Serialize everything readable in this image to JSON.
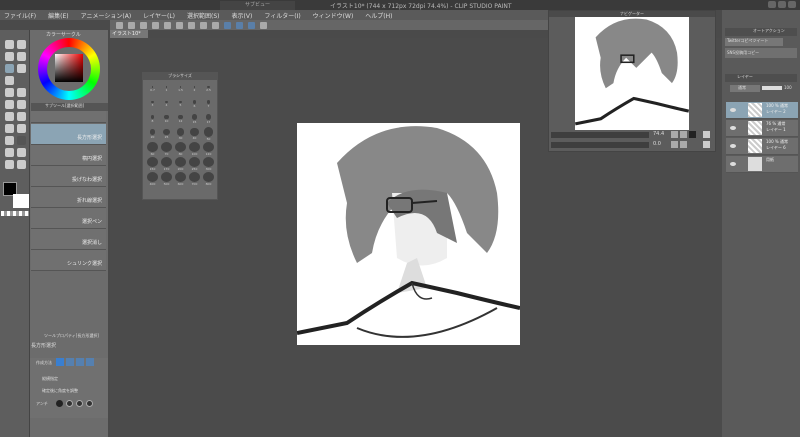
{
  "window": {
    "title": "イラスト10* (744 x 712px 72dpi 74.4%) - CLIP STUDIO PAINT",
    "floating_title_1": "サブビュー",
    "floating_title_2": "ナビゲーター"
  },
  "menu": [
    "ファイル(F)",
    "編集(E)",
    "アニメーション(A)",
    "レイヤー(L)",
    "選択範囲(S)",
    "表示(V)",
    "フィルター(I)",
    "ウィンドウ(W)",
    "ヘルプ(H)"
  ],
  "document_tab": "イラスト10*",
  "color_panel": {
    "title": "カラーサークル",
    "main_color": "#000000",
    "sub_color": "#ffffff"
  },
  "subtool": {
    "title": "サブツール[選択範囲]",
    "items": [
      "長方形選択",
      "楕円選択",
      "投げなわ選択",
      "折れ線選択",
      "選択ペン",
      "選択消し",
      "シュリンク選択"
    ],
    "selected": 0
  },
  "tool_property": {
    "title": "ツールプロパティ[長方形選択]",
    "tool_name": "長方形選択",
    "mode_label": "作成方法",
    "aspect_label": "縦横指定",
    "adjust_label": "確定後に角度を調整",
    "antialias_label": "アンチ"
  },
  "brush_size": {
    "title": "ブラシサイズ",
    "sizes": [
      "0.7",
      "1",
      "1.5",
      "2",
      "2.5",
      "3",
      "4",
      "5",
      "6",
      "7",
      "8",
      "10",
      "12",
      "15",
      "17",
      "20",
      "25",
      "30",
      "40",
      "50",
      "60",
      "70",
      "80",
      "100",
      "120",
      "150",
      "170",
      "200",
      "250",
      "300",
      "400",
      "500",
      "600",
      "700",
      "800"
    ]
  },
  "navigator": {
    "zoom": "74.4",
    "rotation": "0.0"
  },
  "auto_action": {
    "tab": "オートアクション",
    "set": "Twitterコピペツイート",
    "action": "SNS投稿用コピー"
  },
  "layers": {
    "tab": "レイヤー",
    "blend_mode": "通常",
    "opacity": "100",
    "items": [
      {
        "mode": "100 % 通常",
        "name": "レイヤー 2",
        "selected": true
      },
      {
        "mode": "76 % 通常",
        "name": "レイヤー 1",
        "selected": false
      },
      {
        "mode": "100 % 通常",
        "name": "レイヤー 6",
        "selected": false
      },
      {
        "mode": "",
        "name": "用紙",
        "selected": false
      }
    ]
  },
  "colors": {
    "accent": "#8ba4b4",
    "bg": "#4b4b4b"
  }
}
